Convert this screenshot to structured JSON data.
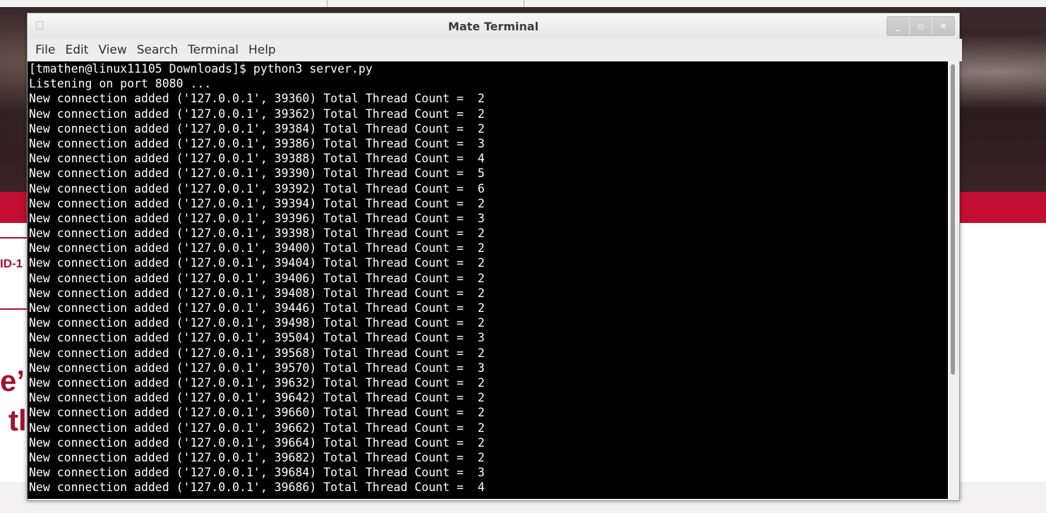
{
  "background_page": {
    "small_text": "ID-1",
    "large_text_line1": "e’r",
    "large_text_line2": "tl"
  },
  "window": {
    "title": "Mate Terminal",
    "buttons": {
      "minimize": "_",
      "maximize": "▫",
      "close": "✕"
    }
  },
  "menu": {
    "items": [
      "File",
      "Edit",
      "View",
      "Search",
      "Terminal",
      "Help"
    ]
  },
  "terminal": {
    "lines": [
      "[tmathen@linux11105 Downloads]$ python3 server.py",
      "Listening on port 8080 ...",
      "New connection added ('127.0.0.1', 39360) Total Thread Count =  2",
      "New connection added ('127.0.0.1', 39362) Total Thread Count =  2",
      "New connection added ('127.0.0.1', 39384) Total Thread Count =  2",
      "New connection added ('127.0.0.1', 39386) Total Thread Count =  3",
      "New connection added ('127.0.0.1', 39388) Total Thread Count =  4",
      "New connection added ('127.0.0.1', 39390) Total Thread Count =  5",
      "New connection added ('127.0.0.1', 39392) Total Thread Count =  6",
      "New connection added ('127.0.0.1', 39394) Total Thread Count =  2",
      "New connection added ('127.0.0.1', 39396) Total Thread Count =  3",
      "New connection added ('127.0.0.1', 39398) Total Thread Count =  2",
      "New connection added ('127.0.0.1', 39400) Total Thread Count =  2",
      "New connection added ('127.0.0.1', 39404) Total Thread Count =  2",
      "New connection added ('127.0.0.1', 39406) Total Thread Count =  2",
      "New connection added ('127.0.0.1', 39408) Total Thread Count =  2",
      "New connection added ('127.0.0.1', 39446) Total Thread Count =  2",
      "New connection added ('127.0.0.1', 39498) Total Thread Count =  2",
      "New connection added ('127.0.0.1', 39504) Total Thread Count =  3",
      "New connection added ('127.0.0.1', 39568) Total Thread Count =  2",
      "New connection added ('127.0.0.1', 39570) Total Thread Count =  3",
      "New connection added ('127.0.0.1', 39632) Total Thread Count =  2",
      "New connection added ('127.0.0.1', 39642) Total Thread Count =  2",
      "New connection added ('127.0.0.1', 39660) Total Thread Count =  2",
      "New connection added ('127.0.0.1', 39662) Total Thread Count =  2",
      "New connection added ('127.0.0.1', 39664) Total Thread Count =  2",
      "New connection added ('127.0.0.1', 39682) Total Thread Count =  2",
      "New connection added ('127.0.0.1', 39684) Total Thread Count =  3",
      "New connection added ('127.0.0.1', 39686) Total Thread Count =  4"
    ]
  }
}
